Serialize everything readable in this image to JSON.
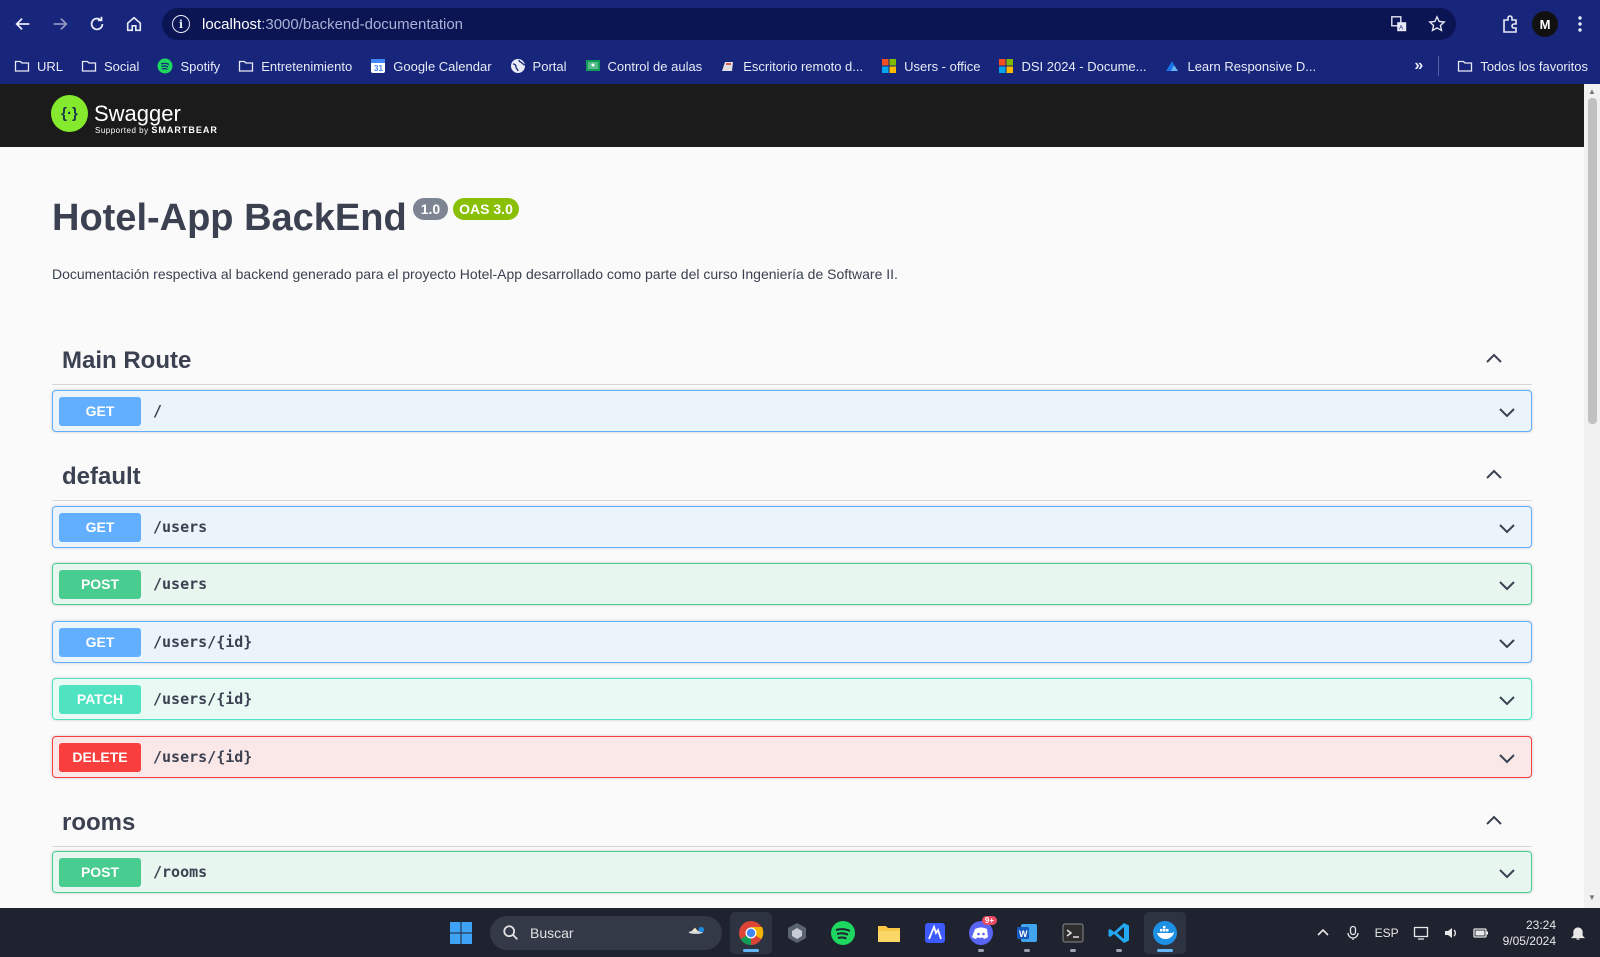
{
  "browser": {
    "url_host": "localhost",
    "url_path": ":3000/backend-documentation",
    "profile_initial": "M",
    "bookmarks": [
      {
        "label": "URL",
        "icon": "folder-icon"
      },
      {
        "label": "Social",
        "icon": "folder-icon"
      },
      {
        "label": "Spotify",
        "icon": "spotify-icon"
      },
      {
        "label": "Entretenimiento",
        "icon": "folder-icon"
      },
      {
        "label": "Google Calendar",
        "icon": "calendar-icon"
      },
      {
        "label": "Portal",
        "icon": "globe-icon"
      },
      {
        "label": "Control de aulas",
        "icon": "classroom-icon"
      },
      {
        "label": "Escritorio remoto d...",
        "icon": "remote-desktop-icon"
      },
      {
        "label": "Users - office",
        "icon": "microsoft-icon"
      },
      {
        "label": "DSI 2024 - Docume...",
        "icon": "microsoft-icon"
      },
      {
        "label": "Learn Responsive D...",
        "icon": "learn-icon"
      }
    ],
    "all_favorites": "Todos los favoritos"
  },
  "swagger": {
    "brand": "Swagger",
    "supported_by": "Supported by",
    "smartbear": "SMARTBEAR"
  },
  "info": {
    "title": "Hotel-App BackEnd",
    "version": "1.0",
    "oas": "OAS 3.0",
    "description": "Documentación respectiva al backend generado para el proyecto Hotel-App desarrollado como parte del curso Ingeniería de Software II."
  },
  "tags": [
    {
      "name": "Main Route"
    },
    {
      "name": "default"
    },
    {
      "name": "rooms"
    }
  ],
  "operations": [
    {
      "method": "GET",
      "path": "/"
    },
    {
      "method": "GET",
      "path": "/users"
    },
    {
      "method": "POST",
      "path": "/users"
    },
    {
      "method": "GET",
      "path": "/users/{id}"
    },
    {
      "method": "PATCH",
      "path": "/users/{id}"
    },
    {
      "method": "DELETE",
      "path": "/users/{id}"
    },
    {
      "method": "POST",
      "path": "/rooms"
    }
  ],
  "taskbar": {
    "search_label": "Buscar",
    "language": "ESP",
    "time": "23:24",
    "date": "9/05/2024",
    "discord_badge": "9+"
  },
  "colors": {
    "browser_frame": "#17257a",
    "swagger_header": "#1b1b1b",
    "get": "#61affe",
    "post": "#49cc90",
    "patch": "#50e3c2",
    "delete": "#f93e3e"
  }
}
